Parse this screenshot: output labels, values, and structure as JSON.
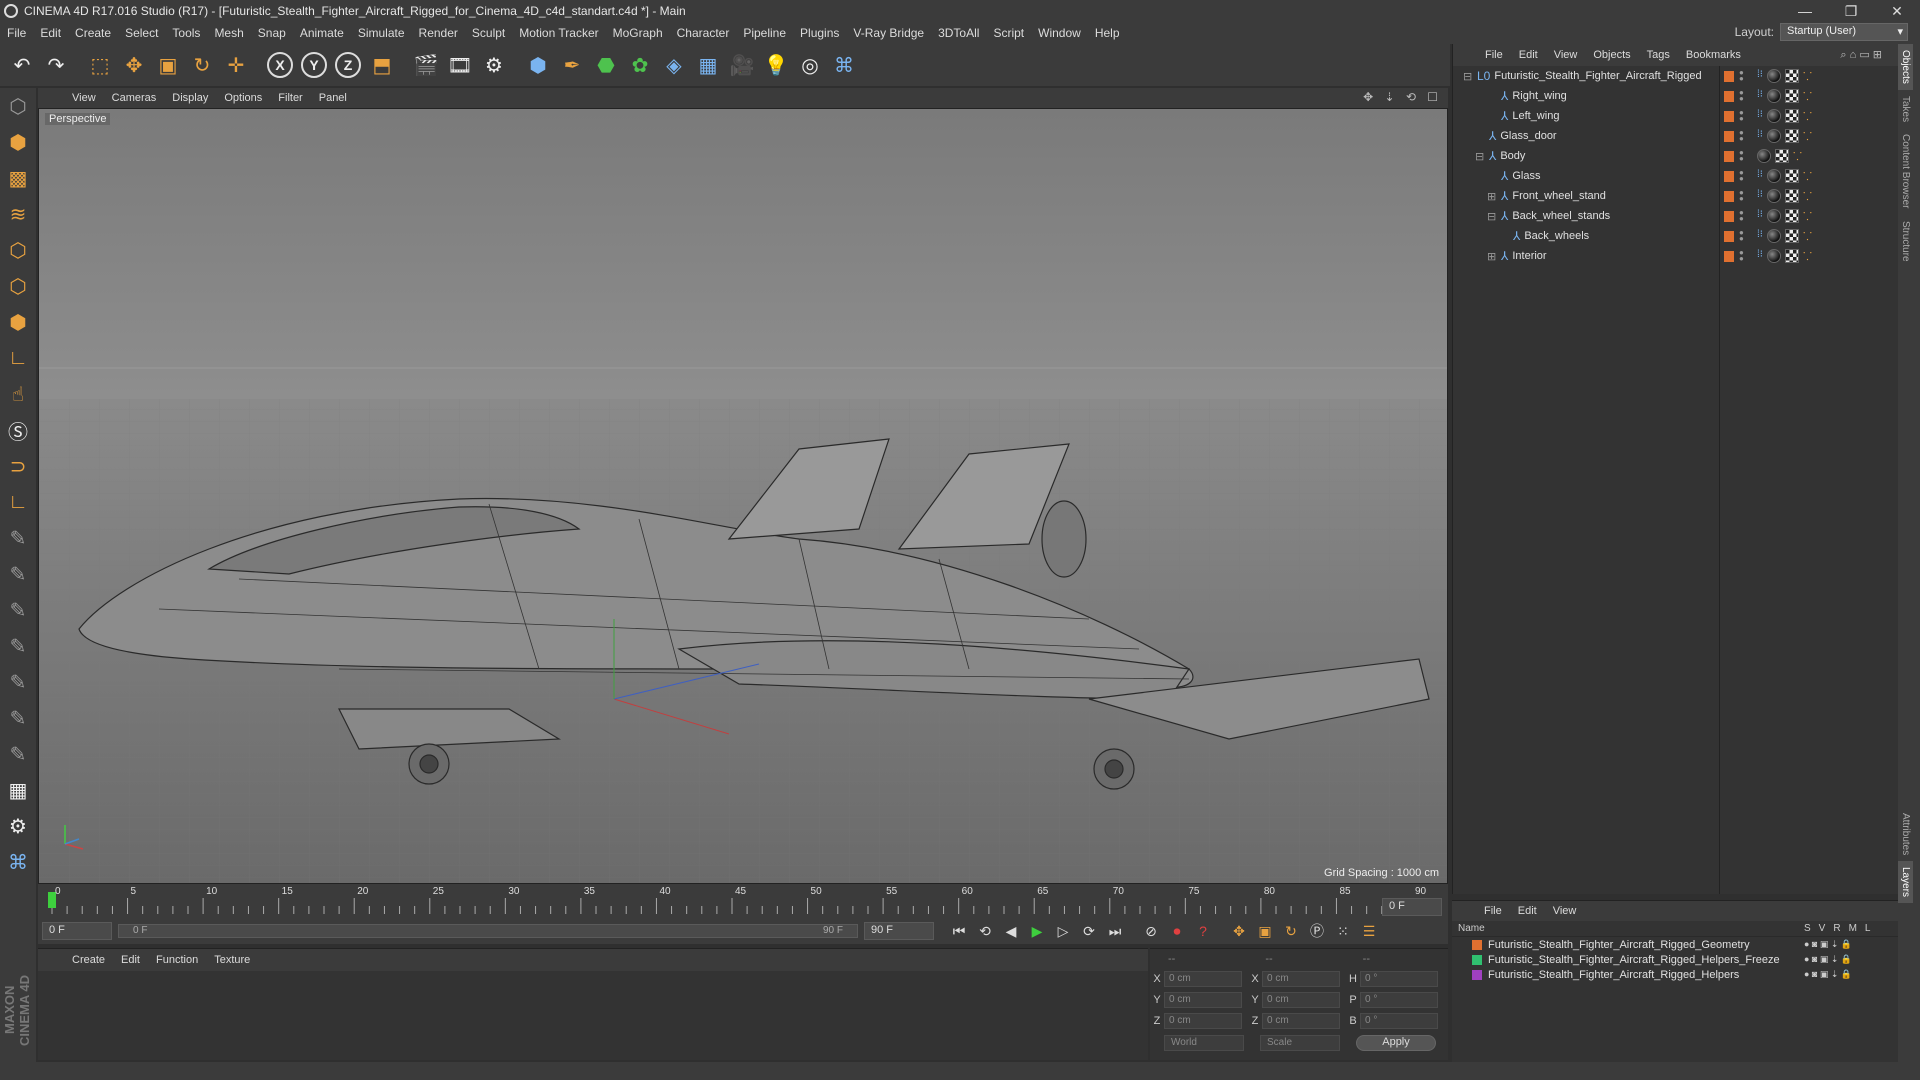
{
  "titlebar": {
    "title": "CINEMA 4D R17.016 Studio (R17) - [Futuristic_Stealth_Fighter_Aircraft_Rigged_for_Cinema_4D_c4d_standart.c4d *] - Main",
    "minimize": "—",
    "maximize": "❐",
    "close": "✕"
  },
  "menubar": {
    "items": [
      "File",
      "Edit",
      "Create",
      "Select",
      "Tools",
      "Mesh",
      "Snap",
      "Animate",
      "Simulate",
      "Render",
      "Sculpt",
      "Motion Tracker",
      "MoGraph",
      "Character",
      "Pipeline",
      "Plugins",
      "V-Ray Bridge",
      "3DToAll",
      "Script",
      "Window",
      "Help"
    ],
    "layout_label": "Layout:",
    "layout_value": "Startup (User)"
  },
  "toolbar": {
    "axis_x": "X",
    "axis_y": "Y",
    "axis_z": "Z"
  },
  "viewport": {
    "menu": [
      "View",
      "Cameras",
      "Display",
      "Options",
      "Filter",
      "Panel"
    ],
    "label": "Perspective",
    "grid_spacing": "Grid Spacing : 1000 cm",
    "nav_icons": "✥ ⇣ ⟲ ☐"
  },
  "timeline": {
    "ticks": [
      "0",
      "5",
      "10",
      "15",
      "20",
      "25",
      "30",
      "35",
      "40",
      "45",
      "50",
      "55",
      "60",
      "65",
      "70",
      "75",
      "80",
      "85",
      "90"
    ],
    "current_frame": "0 F",
    "start_field": "0 F",
    "range_start": "0 F",
    "range_end": "90 F",
    "end_field": "90 F"
  },
  "material_manager": {
    "menu": [
      "Create",
      "Edit",
      "Function",
      "Texture"
    ]
  },
  "coordinates": {
    "top_dashes": [
      "--",
      "--",
      "--"
    ],
    "rows": [
      {
        "axis1": "X",
        "val1": "0 cm",
        "axis2": "X",
        "val2": "0 cm",
        "axis3": "H",
        "val3": "0 °"
      },
      {
        "axis1": "Y",
        "val1": "0 cm",
        "axis2": "Y",
        "val2": "0 cm",
        "axis3": "P",
        "val3": "0 °"
      },
      {
        "axis1": "Z",
        "val1": "0 cm",
        "axis2": "Z",
        "val2": "0 cm",
        "axis3": "B",
        "val3": "0 °"
      }
    ],
    "space": "World",
    "mode": "Scale",
    "apply": "Apply"
  },
  "object_manager": {
    "menu": [
      "File",
      "Edit",
      "View",
      "Objects",
      "Tags",
      "Bookmarks"
    ],
    "objects": [
      {
        "name": "Futuristic_Stealth_Fighter_Aircraft_Rigged",
        "level": 0,
        "expander": "⊟",
        "icon": "L0"
      },
      {
        "name": "Right_wing",
        "level": 2,
        "expander": "",
        "icon": "⅄"
      },
      {
        "name": "Left_wing",
        "level": 2,
        "expander": "",
        "icon": "⅄"
      },
      {
        "name": "Glass_door",
        "level": 1,
        "expander": "",
        "icon": "⅄"
      },
      {
        "name": "Body",
        "level": 1,
        "expander": "⊟",
        "icon": "⅄"
      },
      {
        "name": "Glass",
        "level": 2,
        "expander": "",
        "icon": "⅄"
      },
      {
        "name": "Front_wheel_stand",
        "level": 2,
        "expander": "⊞",
        "icon": "⅄"
      },
      {
        "name": "Back_wheel_stands",
        "level": 2,
        "expander": "⊟",
        "icon": "⅄"
      },
      {
        "name": "Back_wheels",
        "level": 3,
        "expander": "",
        "icon": "⅄"
      },
      {
        "name": "Interior",
        "level": 2,
        "expander": "⊞",
        "icon": "⅄"
      }
    ]
  },
  "layer_manager": {
    "menu": [
      "File",
      "Edit",
      "View"
    ],
    "header_name": "Name",
    "columns": [
      "S",
      "V",
      "R",
      "M",
      "L"
    ],
    "layers": [
      {
        "name": "Futuristic_Stealth_Fighter_Aircraft_Rigged_Geometry",
        "color": "#e07030"
      },
      {
        "name": "Futuristic_Stealth_Fighter_Aircraft_Rigged_Helpers_Freeze",
        "color": "#30c070"
      },
      {
        "name": "Futuristic_Stealth_Fighter_Aircraft_Rigged_Helpers",
        "color": "#a040c0"
      }
    ]
  },
  "right_tabs": [
    "Objects",
    "Takes",
    "Content Browser",
    "Structure",
    "Attributes",
    "Layers"
  ],
  "branding": "MAXON CINEMA 4D"
}
